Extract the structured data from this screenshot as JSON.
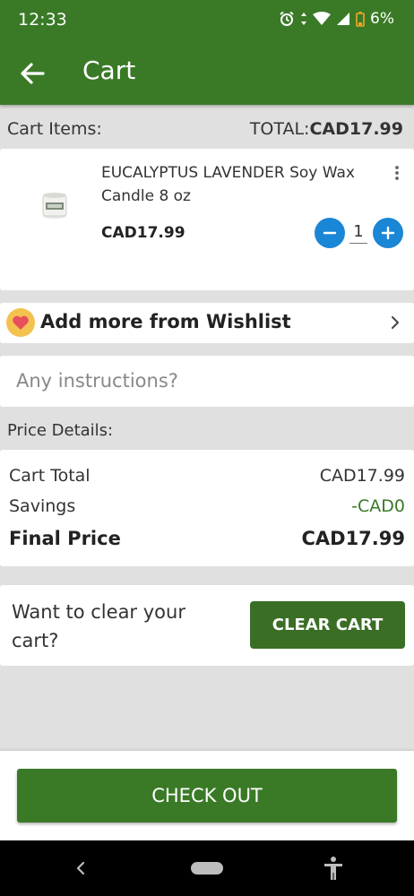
{
  "status_bar": {
    "time": "12:33",
    "battery": "6%"
  },
  "app_bar": {
    "title": "Cart"
  },
  "cart_items": {
    "label": "Cart Items:",
    "total_prefix": "TOTAL:",
    "total_value": "CAD17.99",
    "items": [
      {
        "name": "EUCALYPTUS LAVENDER Soy Wax Candle 8 oz",
        "price": "CAD17.99",
        "quantity": "1"
      }
    ]
  },
  "wishlist": {
    "label": "Add more from Wishlist"
  },
  "instructions": {
    "placeholder": "Any instructions?"
  },
  "price_details": {
    "header": "Price Details:",
    "cart_total_label": "Cart Total",
    "cart_total_value": "CAD17.99",
    "savings_label": "Savings",
    "savings_value": "-CAD0",
    "final_label": "Final Price",
    "final_value": "CAD17.99"
  },
  "clear_cart": {
    "prompt": "Want to clear your cart?",
    "button_label": "CLEAR CART"
  },
  "checkout": {
    "button_label": "CHECK OUT"
  },
  "colors": {
    "brand_green": "#3a7a27",
    "qty_blue": "#1a86d6",
    "savings_green": "#3a7a27"
  }
}
